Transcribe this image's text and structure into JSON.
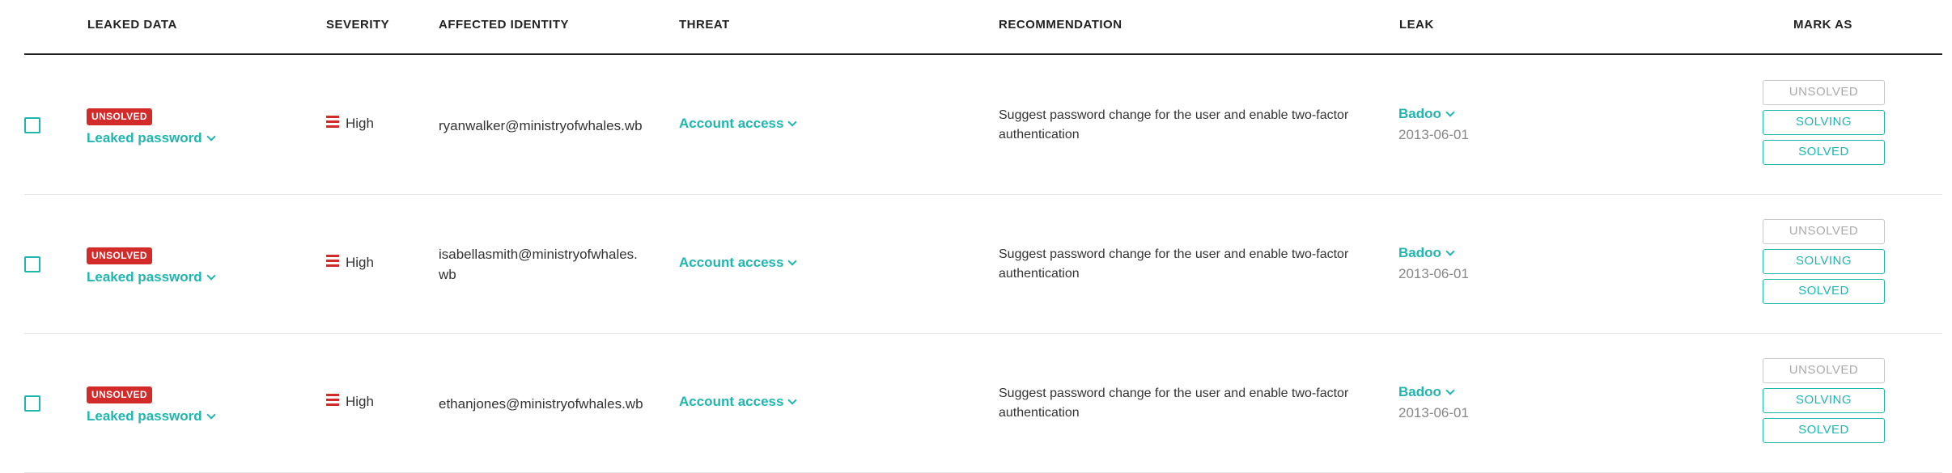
{
  "header": {
    "leaked_data": "LEAKED DATA",
    "severity": "SEVERITY",
    "affected_identity": "AFFECTED IDENTITY",
    "threat": "THREAT",
    "recommendation": "RECOMMENDATION",
    "leak": "LEAK",
    "mark_as": "MARK AS"
  },
  "rows": [
    {
      "status_badge": "UNSOLVED",
      "leaked_data": "Leaked password",
      "severity": "High",
      "identity": "ryanwalker@ministryofwhales.wb",
      "threat": "Account access",
      "recommendation": "Suggest password change for the user and enable two-factor authentication",
      "leak_name": "Badoo",
      "leak_date": "2013-06-01",
      "mark": {
        "unsolved": "UNSOLVED",
        "solving": "SOLVING",
        "solved": "SOLVED"
      }
    },
    {
      "status_badge": "UNSOLVED",
      "leaked_data": "Leaked password",
      "severity": "High",
      "identity": "isabellasmith@ministryofwhales.wb",
      "threat": "Account access",
      "recommendation": "Suggest password change for the user and enable two-factor authentication",
      "leak_name": "Badoo",
      "leak_date": "2013-06-01",
      "mark": {
        "unsolved": "UNSOLVED",
        "solving": "SOLVING",
        "solved": "SOLVED"
      }
    },
    {
      "status_badge": "UNSOLVED",
      "leaked_data": "Leaked password",
      "severity": "High",
      "identity": "ethanjones@ministryofwhales.wb",
      "threat": "Account access",
      "recommendation": "Suggest password change for the user and enable two-factor authentication",
      "leak_name": "Badoo",
      "leak_date": "2013-06-01",
      "mark": {
        "unsolved": "UNSOLVED",
        "solving": "SOLVING",
        "solved": "SOLVED"
      }
    }
  ],
  "colors": {
    "accent": "#20b6b0",
    "danger": "#d32a2a",
    "muted": "#888888"
  },
  "icons": {
    "severity": "severity-bars-icon",
    "dropdown": "chevron-down-icon"
  }
}
